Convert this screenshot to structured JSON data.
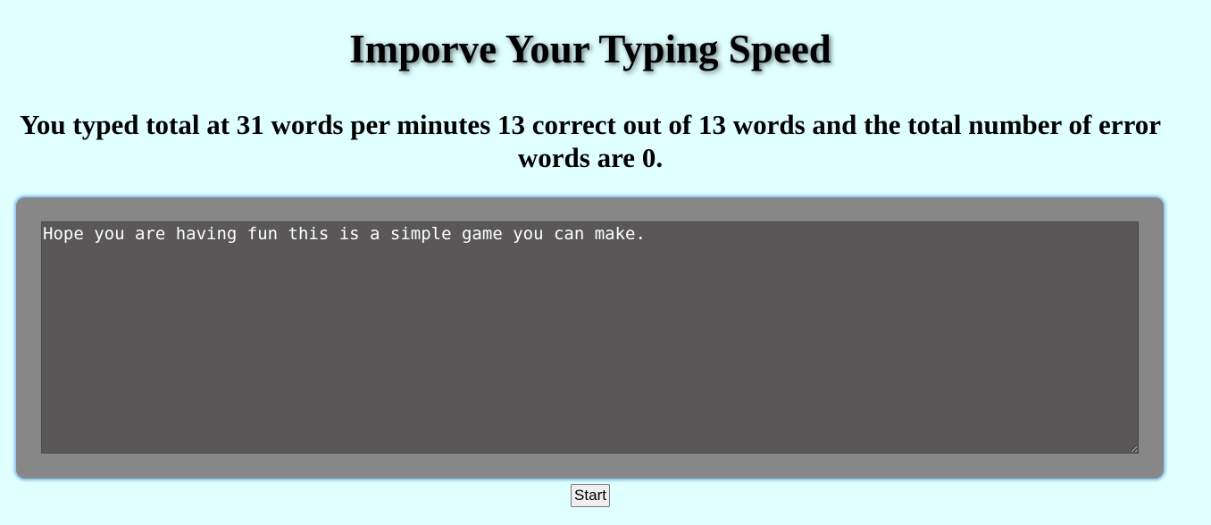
{
  "page": {
    "title": "Imporve Your Typing Speed",
    "result": "You typed total at 31 words per minutes 13 correct out of 13 words and the total number of error words are 0."
  },
  "typing_area": {
    "value": "Hope you are having fun this is a simple game you can make."
  },
  "controls": {
    "start_label": "Start"
  },
  "colors": {
    "page_background": "#e0ffff",
    "panel_background": "#878787",
    "panel_border": "#9ccff3",
    "textarea_background": "#595758",
    "textarea_text": "#ffffff"
  }
}
